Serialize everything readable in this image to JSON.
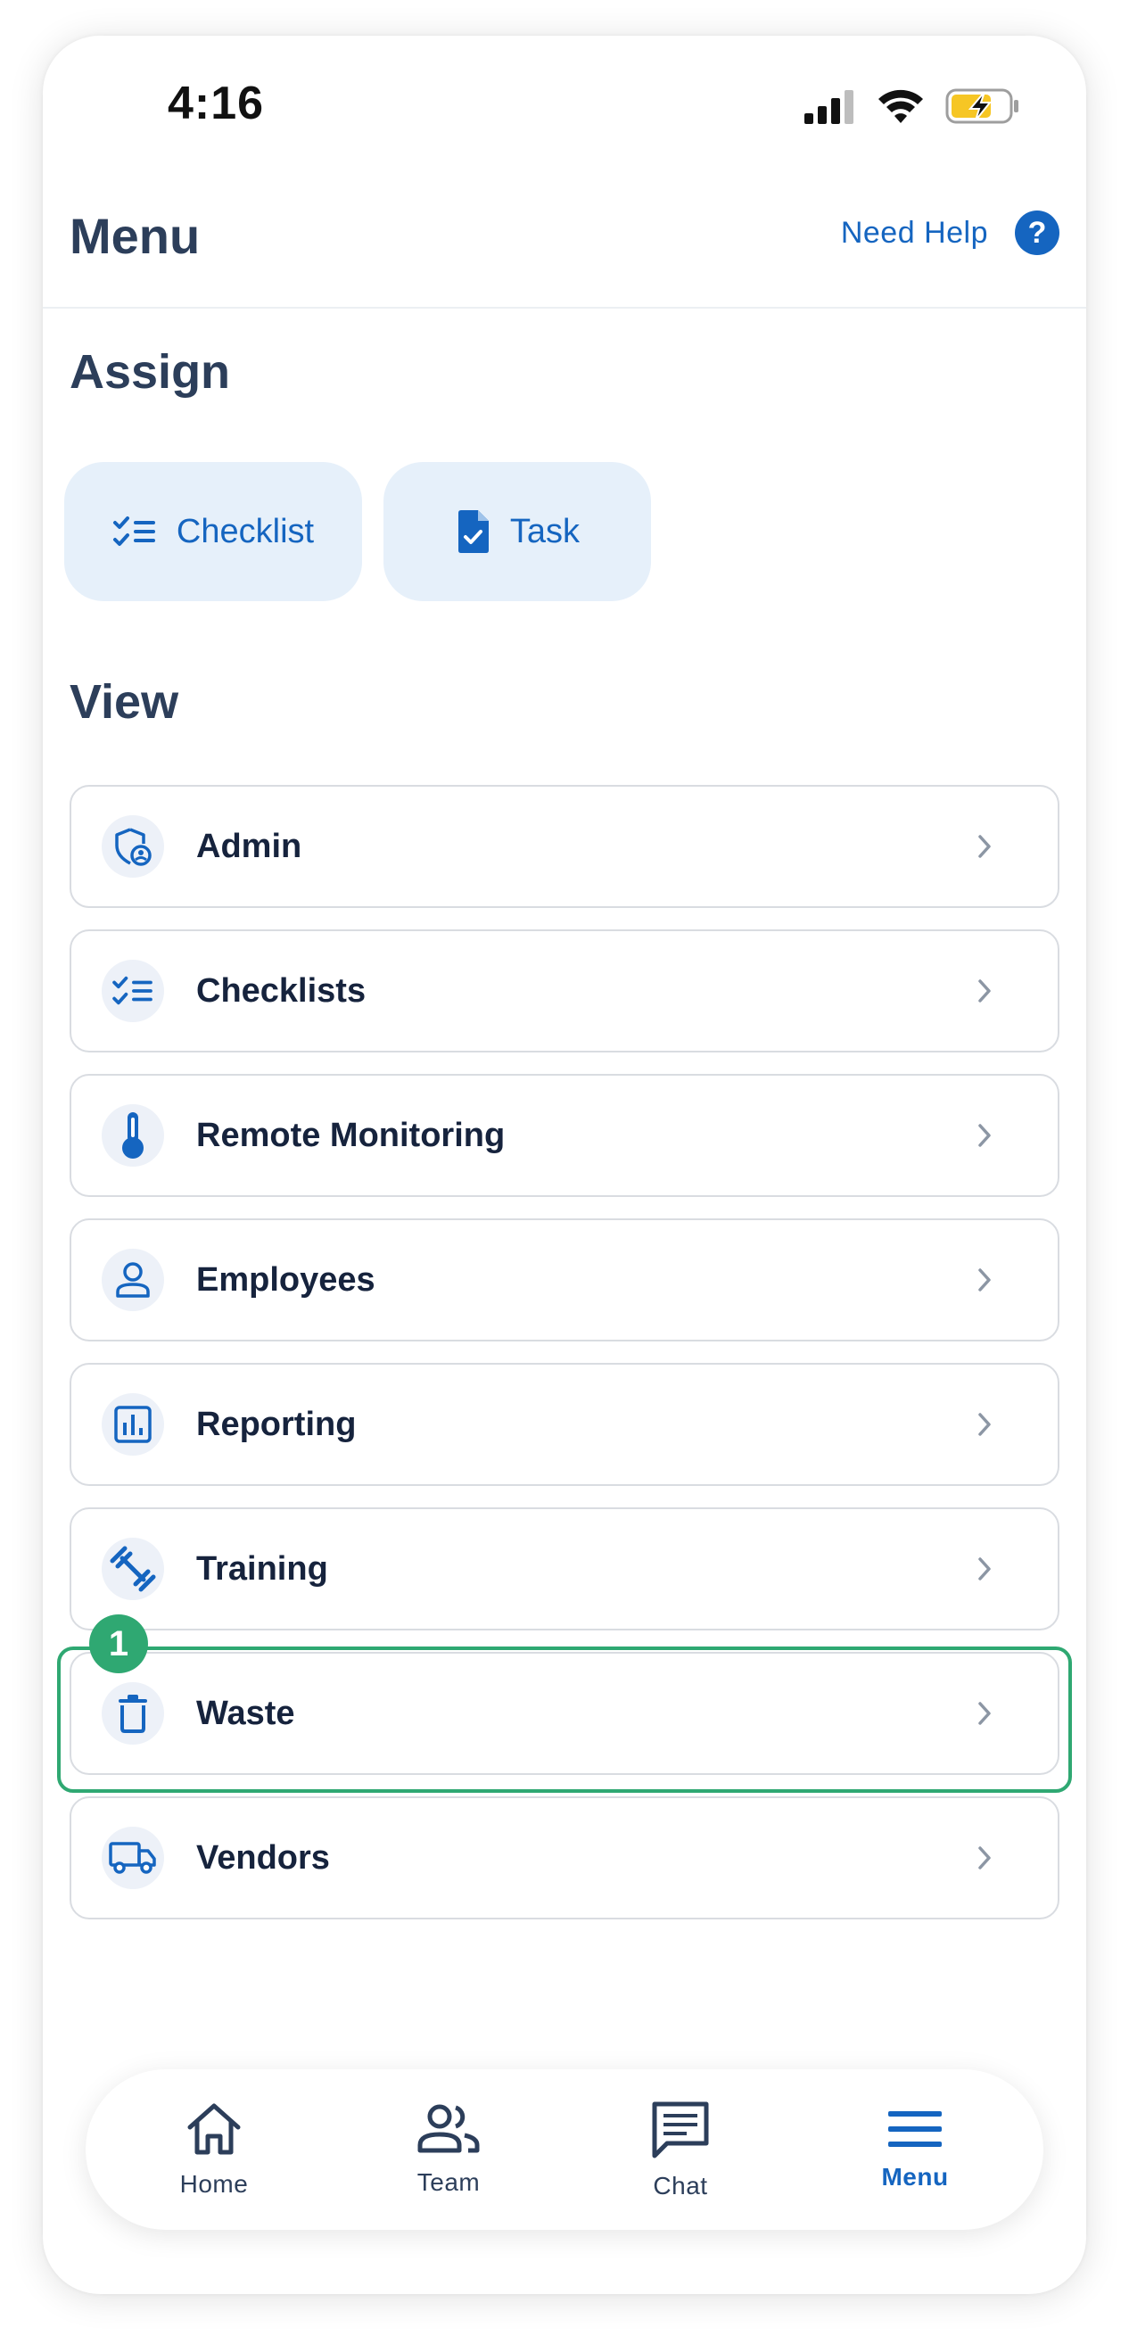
{
  "status_bar": {
    "time": "4:16"
  },
  "header": {
    "title": "Menu",
    "help_label": "Need Help",
    "help_symbol": "?"
  },
  "assign": {
    "title": "Assign",
    "buttons": [
      {
        "label": "Checklist",
        "icon": "checklist-icon"
      },
      {
        "label": "Task",
        "icon": "task-document-icon"
      }
    ]
  },
  "view": {
    "title": "View",
    "items": [
      {
        "label": "Admin",
        "icon": "shield-user-icon"
      },
      {
        "label": "Checklists",
        "icon": "checklist-icon"
      },
      {
        "label": "Remote Monitoring",
        "icon": "thermometer-icon"
      },
      {
        "label": "Employees",
        "icon": "person-icon"
      },
      {
        "label": "Reporting",
        "icon": "bar-chart-icon"
      },
      {
        "label": "Training",
        "icon": "dumbbell-icon"
      },
      {
        "label": "Waste",
        "icon": "trash-icon"
      },
      {
        "label": "Vendors",
        "icon": "truck-icon"
      }
    ],
    "highlighted_step": "1"
  },
  "bottom_nav": {
    "items": [
      {
        "label": "Home",
        "icon": "home-icon"
      },
      {
        "label": "Team",
        "icon": "team-icon"
      },
      {
        "label": "Chat",
        "icon": "chat-icon"
      },
      {
        "label": "Menu",
        "icon": "hamburger-menu-icon",
        "active": true
      }
    ]
  },
  "colors": {
    "primary": "#1565c0",
    "heading": "#2c3e5a",
    "highlight": "#2fa872",
    "assign_bg": "#e6f0fa",
    "battery_fill": "#f6c624"
  }
}
